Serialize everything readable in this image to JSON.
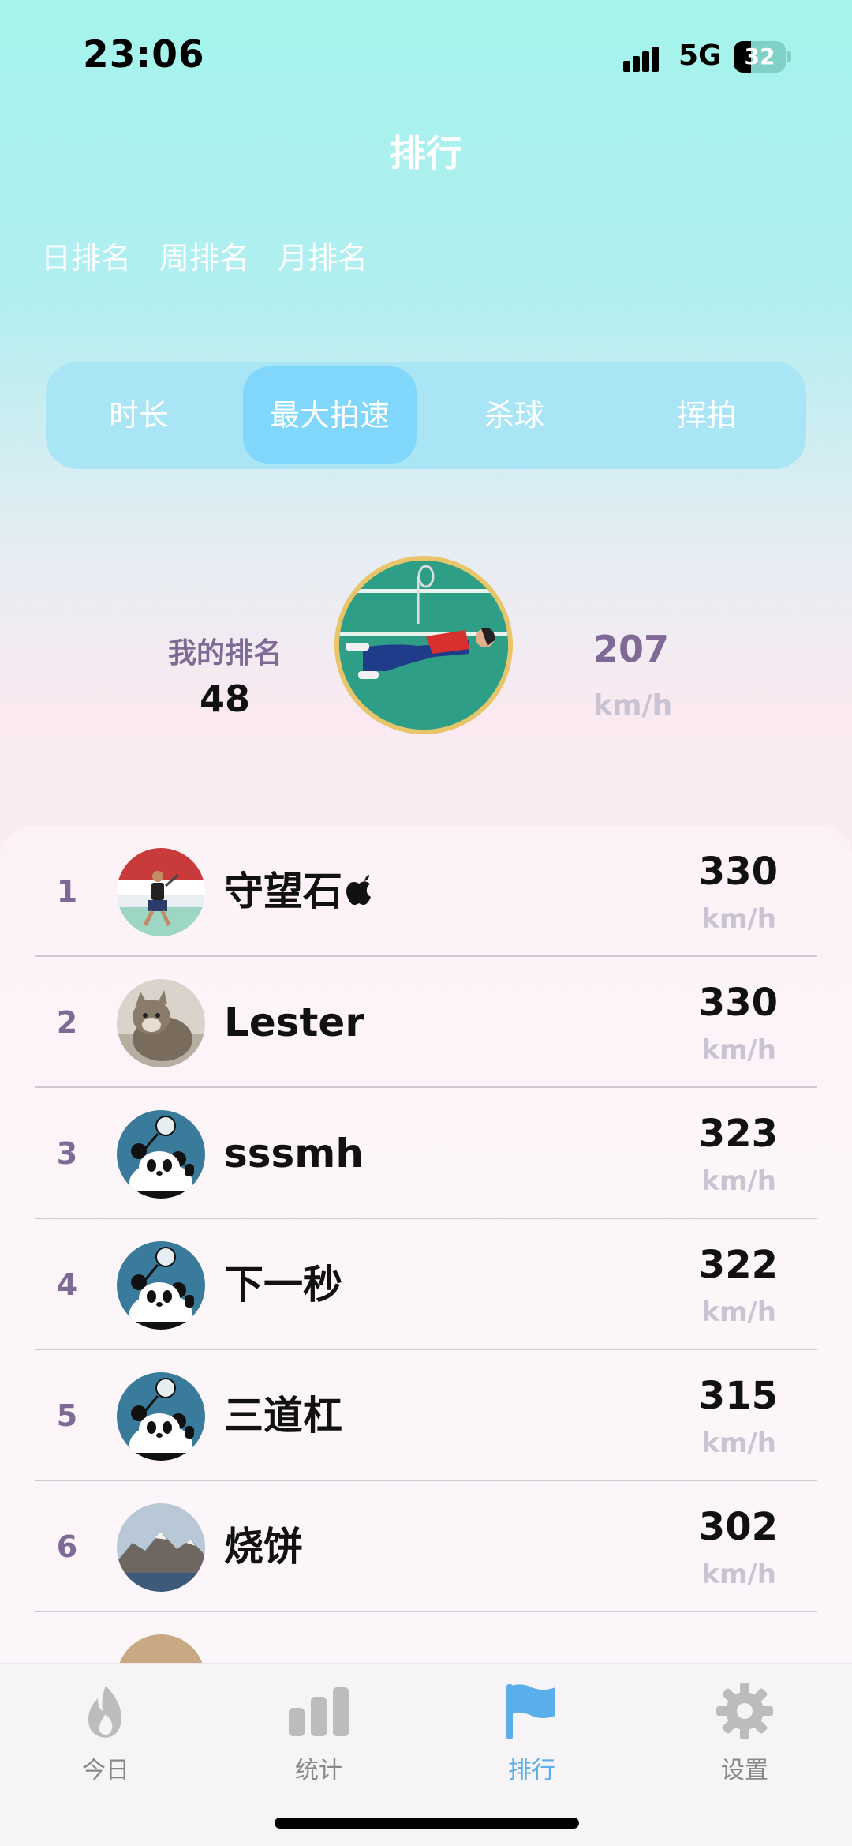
{
  "status_bar": {
    "time": "23:06",
    "network": "5G",
    "battery": "32"
  },
  "page_title": "排行",
  "period_tabs": [
    "日排名",
    "周排名",
    "月排名"
  ],
  "metric_tabs": [
    "时长",
    "最大拍速",
    "杀球",
    "挥拍"
  ],
  "active_metric": "最大拍速",
  "my_rank": {
    "label": "我的排名",
    "value": "48",
    "speed": "207",
    "unit": "km/h"
  },
  "leaderboard": [
    {
      "rank": "1",
      "name": "守望石",
      "value": "330",
      "unit": "km/h",
      "avatar": "player-photo"
    },
    {
      "rank": "2",
      "name": "Lester",
      "value": "330",
      "unit": "km/h",
      "avatar": "cat-photo"
    },
    {
      "rank": "3",
      "name": "sssmh",
      "value": "323",
      "unit": "km/h",
      "avatar": "panda-icon"
    },
    {
      "rank": "4",
      "name": "下一秒",
      "value": "322",
      "unit": "km/h",
      "avatar": "panda-icon"
    },
    {
      "rank": "5",
      "name": "三道杠",
      "value": "315",
      "unit": "km/h",
      "avatar": "panda-icon"
    },
    {
      "rank": "6",
      "name": "烧饼",
      "value": "302",
      "unit": "km/h",
      "avatar": "mountain-photo"
    }
  ],
  "tab_bar": [
    {
      "label": "今日",
      "icon": "flame-icon"
    },
    {
      "label": "统计",
      "icon": "bar-chart-icon"
    },
    {
      "label": "排行",
      "icon": "flag-icon",
      "active": true
    },
    {
      "label": "设置",
      "icon": "gear-icon"
    }
  ],
  "colors": {
    "accent": "#5aaeea",
    "rank_purple": "#7f6a95",
    "unit_gray": "#c9c3d3",
    "tab_active_bg": "#80d7fb"
  }
}
